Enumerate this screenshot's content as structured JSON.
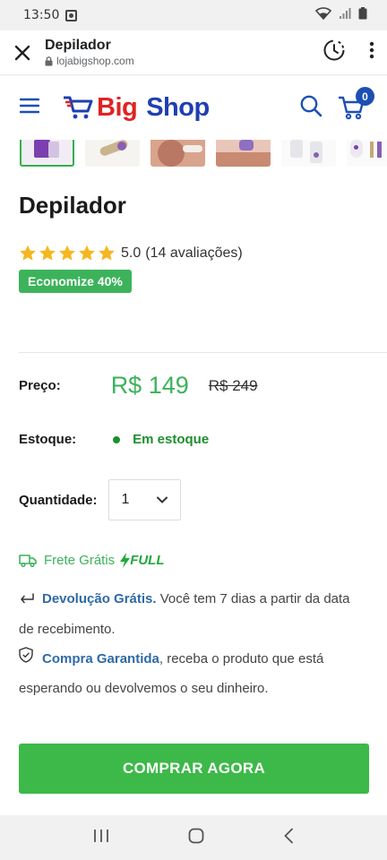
{
  "status_bar": {
    "time": "13:50"
  },
  "browser": {
    "title": "Depilador",
    "url": "lojabigshop.com"
  },
  "site": {
    "logo_big": "Big",
    "logo_shop": "Shop",
    "cart_count": "0"
  },
  "product": {
    "title": "Depilador",
    "rating_value": "5.0",
    "rating_count_text": "(14 avaliações)",
    "stars": 5,
    "discount_badge": "Economize 40%",
    "price_label": "Preço:",
    "price": "R$ 149",
    "old_price": "R$ 249",
    "stock_label": "Estoque:",
    "stock_status": "Em estoque",
    "quantity_label": "Quantidade:",
    "quantity_value": "1",
    "shipping_text": "Frete Grátis",
    "shipping_badge": "FULL",
    "return_highlight": "Devolução Grátis.",
    "return_text": " Você tem 7 dias a partir da data de recebimento.",
    "guarantee_highlight": "Compra Garantida",
    "guarantee_text": ", receba o produto que está esperando ou devolvemos o seu dinheiro.",
    "buy_button": "COMPRAR AGORA"
  },
  "colors": {
    "green": "#3cb35a",
    "brand_red": "#e02323",
    "brand_blue": "#1f3fb0",
    "link_blue": "#2f6aa6"
  }
}
